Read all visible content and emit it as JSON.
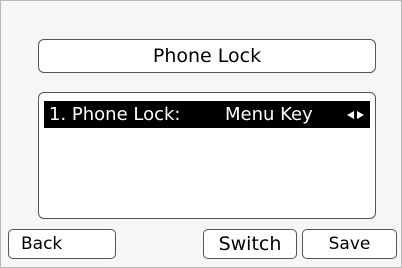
{
  "header": {
    "title": "Phone Lock"
  },
  "list": {
    "items": [
      {
        "label": "1. Phone Lock:",
        "value": "Menu Key",
        "icon": "left-right-arrows-icon",
        "selected": true
      }
    ]
  },
  "softkeys": {
    "back_label": "Back",
    "switch_label": "Switch",
    "save_label": "Save"
  },
  "colors": {
    "selection_bg": "#000000",
    "selection_fg": "#ffffff",
    "background": "#f6f6f6"
  }
}
